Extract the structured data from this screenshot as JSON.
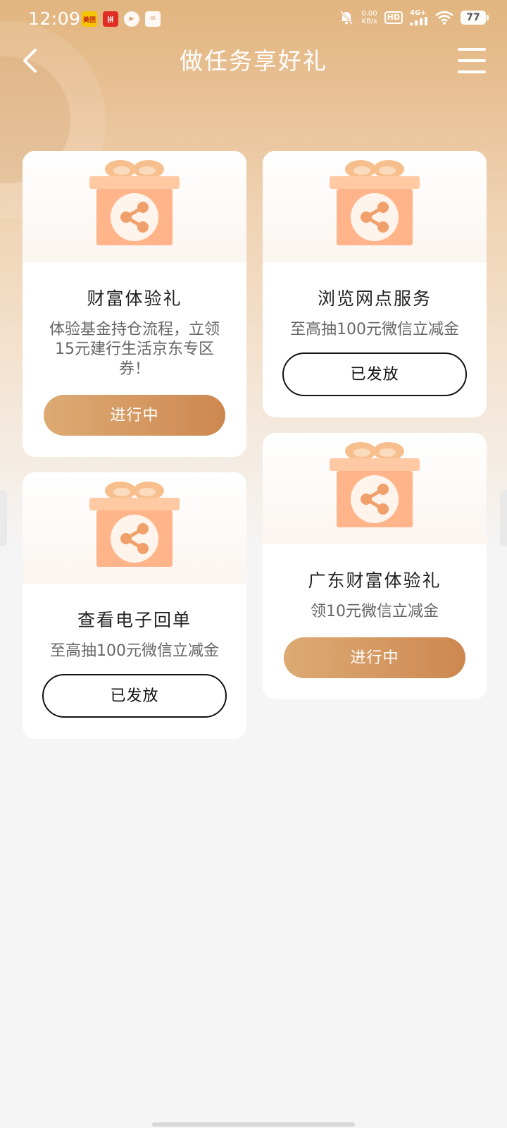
{
  "status_bar": {
    "time": "12:09",
    "notification_icons": [
      {
        "name": "meituan-app-icon",
        "glyph": "美团"
      },
      {
        "name": "pinduoduo-app-icon",
        "glyph": "拼"
      },
      {
        "name": "video-app-icon",
        "glyph": "▶"
      },
      {
        "name": "mail-app-icon",
        "glyph": "✉"
      }
    ],
    "net_speed_value": "0.00",
    "net_speed_unit": "KB/s",
    "hd_label": "HD",
    "network_label": "4G+",
    "battery_level": "77"
  },
  "header": {
    "title": "做任务享好礼"
  },
  "tasks": [
    {
      "title": "财富体验礼",
      "description": "体验基金持仓流程，立领15元建行生活京东专区券！",
      "button_label": "进行中",
      "status": "in_progress"
    },
    {
      "title": "浏览网点服务",
      "description": "至高抽100元微信立减金",
      "button_label": "已发放",
      "status": "issued"
    },
    {
      "title": "查看电子回单",
      "description": "至高抽100元微信立减金",
      "button_label": "已发放",
      "status": "issued"
    },
    {
      "title": "广东财富体验礼",
      "description": "领10元微信立减金",
      "button_label": "进行中",
      "status": "in_progress"
    }
  ],
  "colors": {
    "header_gradient_start": "#e2b57f",
    "button_gradient_start": "#ddaa74",
    "button_gradient_end": "#cd8850",
    "gift_box": "#ffb48a",
    "share_icon": "#f0a06a"
  }
}
